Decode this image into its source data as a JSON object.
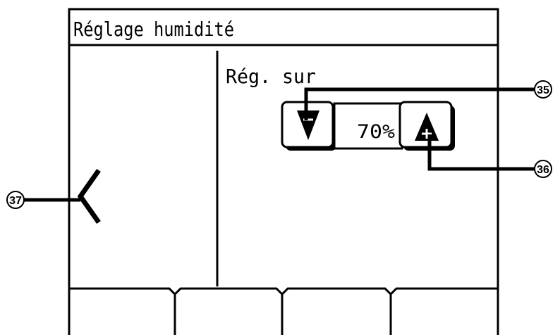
{
  "screen": {
    "title": "Réglage humidité",
    "setpoint_label": "Rég. sur",
    "humidity_value": "70%"
  },
  "controls": {
    "decrease_icon": "triangle-down-minus-icon",
    "increase_icon": "triangle-up-plus-icon",
    "back_icon": "chevron-left-icon"
  },
  "callouts": {
    "decrease": "35",
    "increase": "36",
    "back": "37"
  },
  "function_keys": [
    "",
    "",
    "",
    ""
  ]
}
